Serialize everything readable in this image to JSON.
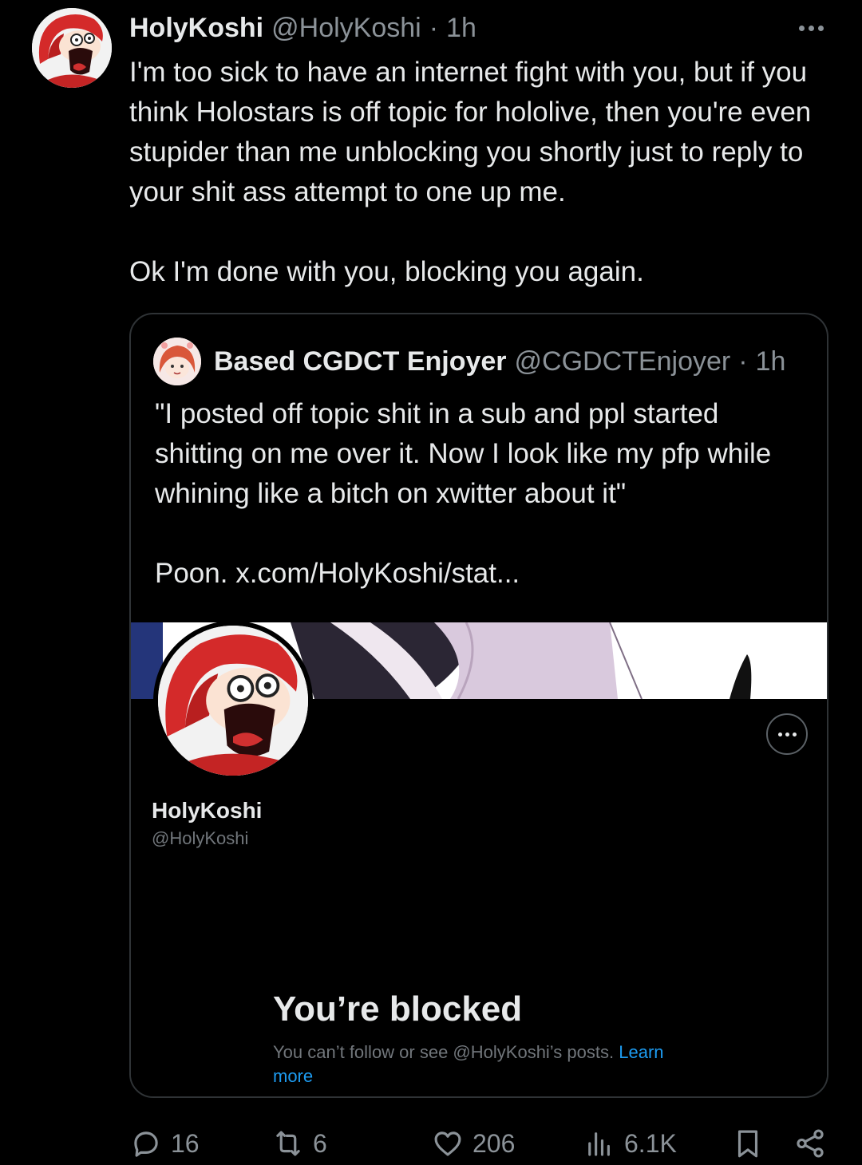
{
  "tweet": {
    "display_name": "HolyKoshi",
    "handle": "@HolyKoshi",
    "separator": "·",
    "time": "1h",
    "text_p1": "I'm too sick to have an internet fight with you, but if you think Holostars is off topic for hololive, then you're even stupider than me unblocking you shortly just to reply to your shit ass attempt to one up me.",
    "text_p2": "Ok I'm done with you, blocking you again."
  },
  "quote": {
    "display_name": "Based CGDCT Enjoyer",
    "handle": "@CGDCTEnjoyer",
    "separator": "·",
    "time": "1h",
    "text_p1": "\"I posted off topic shit in a sub and ppl started shitting on me over it. Now I look like my pfp while whining like a bitch on xwitter about it\"",
    "text_p2_prefix": "Poon. ",
    "link": "x.com/HolyKoshi/stat..."
  },
  "embedded_profile": {
    "name": "HolyKoshi",
    "handle": "@HolyKoshi",
    "blocked_title": "You’re blocked",
    "blocked_desc": "You can’t follow or see @HolyKoshi’s posts. ",
    "learn_more": "Learn more"
  },
  "actions": {
    "replies": "16",
    "reposts": "6",
    "likes": "206",
    "views": "6.1K"
  },
  "icons": [
    "more-icon",
    "reply-icon",
    "repost-icon",
    "like-icon",
    "views-icon",
    "bookmark-icon",
    "share-icon"
  ],
  "colors": {
    "background": "#000000",
    "text": "#e7e9ea",
    "muted": "#8b9298",
    "border": "#2f3336",
    "link": "#1d9bf0",
    "avatar_hair": "#d42a2a"
  }
}
